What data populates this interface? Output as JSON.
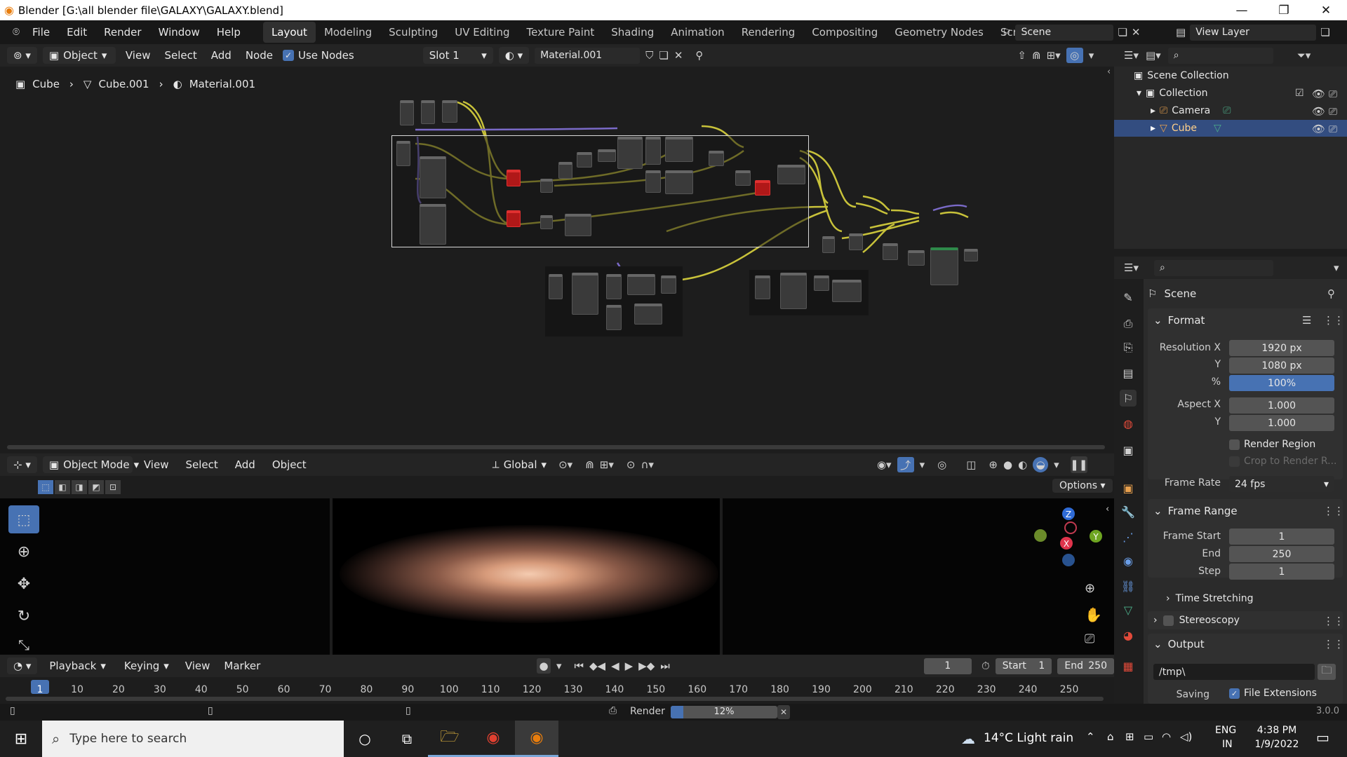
{
  "window": {
    "title": "Blender [G:\\all blender file\\GALAXY\\GALAXY.blend]"
  },
  "menu": {
    "file": "File",
    "edit": "Edit",
    "render": "Render",
    "window": "Window",
    "help": "Help"
  },
  "workspaces": [
    "Layout",
    "Modeling",
    "Sculpting",
    "UV Editing",
    "Texture Paint",
    "Shading",
    "Animation",
    "Rendering",
    "Compositing",
    "Geometry Nodes",
    "Scripting"
  ],
  "scene": {
    "scene_name": "Scene",
    "view_layer": "View Layer"
  },
  "node_editor": {
    "object_mode": "Object",
    "view": "View",
    "select": "Select",
    "add": "Add",
    "node": "Node",
    "use_nodes": "Use Nodes",
    "slot": "Slot 1",
    "material": "Material.001",
    "breadcrumb": [
      "Cube",
      "Cube.001",
      "Material.001"
    ]
  },
  "viewport": {
    "mode": "Object Mode",
    "view": "View",
    "select": "Select",
    "add": "Add",
    "object": "Object",
    "orientation": "Global",
    "options": "Options",
    "gizmo": {
      "z": "Z",
      "y": "Y",
      "x": "X"
    }
  },
  "timeline": {
    "playback": "Playback",
    "keying": "Keying",
    "view": "View",
    "marker": "Marker",
    "current_frame": "1",
    "start_label": "Start",
    "start": "1",
    "end_label": "End",
    "end": "250",
    "ticks": [
      "1",
      "10",
      "20",
      "30",
      "40",
      "50",
      "60",
      "70",
      "80",
      "90",
      "100",
      "110",
      "120",
      "130",
      "140",
      "150",
      "160",
      "170",
      "180",
      "190",
      "200",
      "210",
      "220",
      "230",
      "240",
      "250"
    ]
  },
  "status": {
    "render_label": "Render",
    "progress_percent": "12%",
    "progress_value": 0.12,
    "version": "3.0.0"
  },
  "outliner": {
    "scene_collection": "Scene Collection",
    "items": [
      {
        "name": "Collection"
      },
      {
        "name": "Camera"
      },
      {
        "name": "Cube"
      }
    ]
  },
  "properties": {
    "context": "Scene",
    "format": {
      "title": "Format",
      "res_x_label": "Resolution X",
      "res_x": "1920 px",
      "res_y_label": "Y",
      "res_y": "1080 px",
      "pct_label": "%",
      "pct": "100%",
      "aspect_x_label": "Aspect X",
      "aspect_x": "1.000",
      "aspect_y_label": "Y",
      "aspect_y": "1.000",
      "render_region": "Render Region",
      "crop": "Crop to Render R...",
      "frame_rate_label": "Frame Rate",
      "frame_rate": "24 fps"
    },
    "frame_range": {
      "title": "Frame Range",
      "start_label": "Frame Start",
      "start": "1",
      "end_label": "End",
      "end": "250",
      "step_label": "Step",
      "step": "1",
      "time_stretching": "Time Stretching"
    },
    "stereoscopy": "Stereoscopy",
    "output": {
      "title": "Output",
      "path": "/tmp\\",
      "saving_label": "Saving",
      "file_ext": "File Extensions"
    }
  },
  "taskbar": {
    "search_placeholder": "Type here to search",
    "weather": "14°C  Light rain",
    "lang1": "ENG",
    "lang2": "IN",
    "time": "4:38 PM",
    "date": "1/9/2022"
  },
  "colors": {
    "accent": "#4772b3",
    "bg": "#1d1d1d",
    "header": "#242424",
    "node_red": "#b01818",
    "link_yellow": "#c8c23a",
    "link_purple": "#7a6ac8"
  }
}
